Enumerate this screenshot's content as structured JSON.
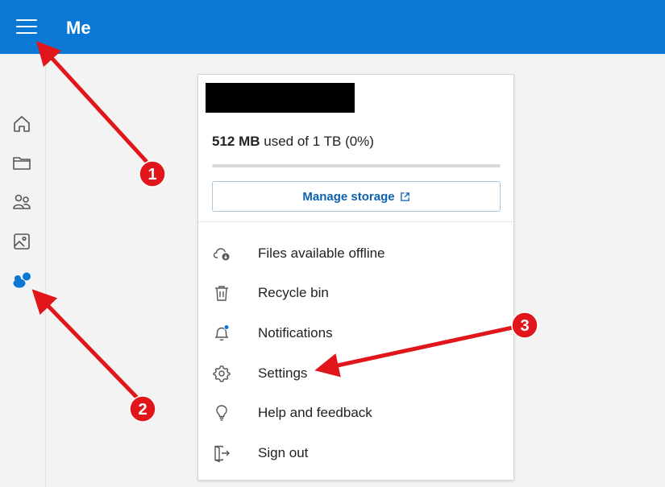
{
  "header": {
    "title": "Me",
    "menu_icon": "hamburger-menu-icon",
    "bar_color": "#0a78d4"
  },
  "siderail": {
    "items": [
      {
        "name": "home",
        "icon": "home-icon"
      },
      {
        "name": "files",
        "icon": "folder-icon"
      },
      {
        "name": "shared",
        "icon": "people-icon"
      },
      {
        "name": "photos",
        "icon": "image-icon"
      },
      {
        "name": "me",
        "icon": "me-people-icon",
        "active": true
      }
    ]
  },
  "account_card": {
    "storage": {
      "used": "512 MB",
      "rest": "used of 1 TB (0%)",
      "fraction": 0
    },
    "manage_storage_label": "Manage storage",
    "menu": [
      {
        "label": "Files available offline",
        "icon": "cloud-offline-icon"
      },
      {
        "label": "Recycle bin",
        "icon": "trash-icon"
      },
      {
        "label": "Notifications",
        "icon": "bell-icon"
      },
      {
        "label": "Settings",
        "icon": "gear-icon"
      },
      {
        "label": "Help and feedback",
        "icon": "lightbulb-icon"
      },
      {
        "label": "Sign out",
        "icon": "sign-out-icon"
      }
    ]
  },
  "annotations": {
    "badges": [
      "1",
      "2",
      "3"
    ],
    "color": "#e0161b"
  }
}
